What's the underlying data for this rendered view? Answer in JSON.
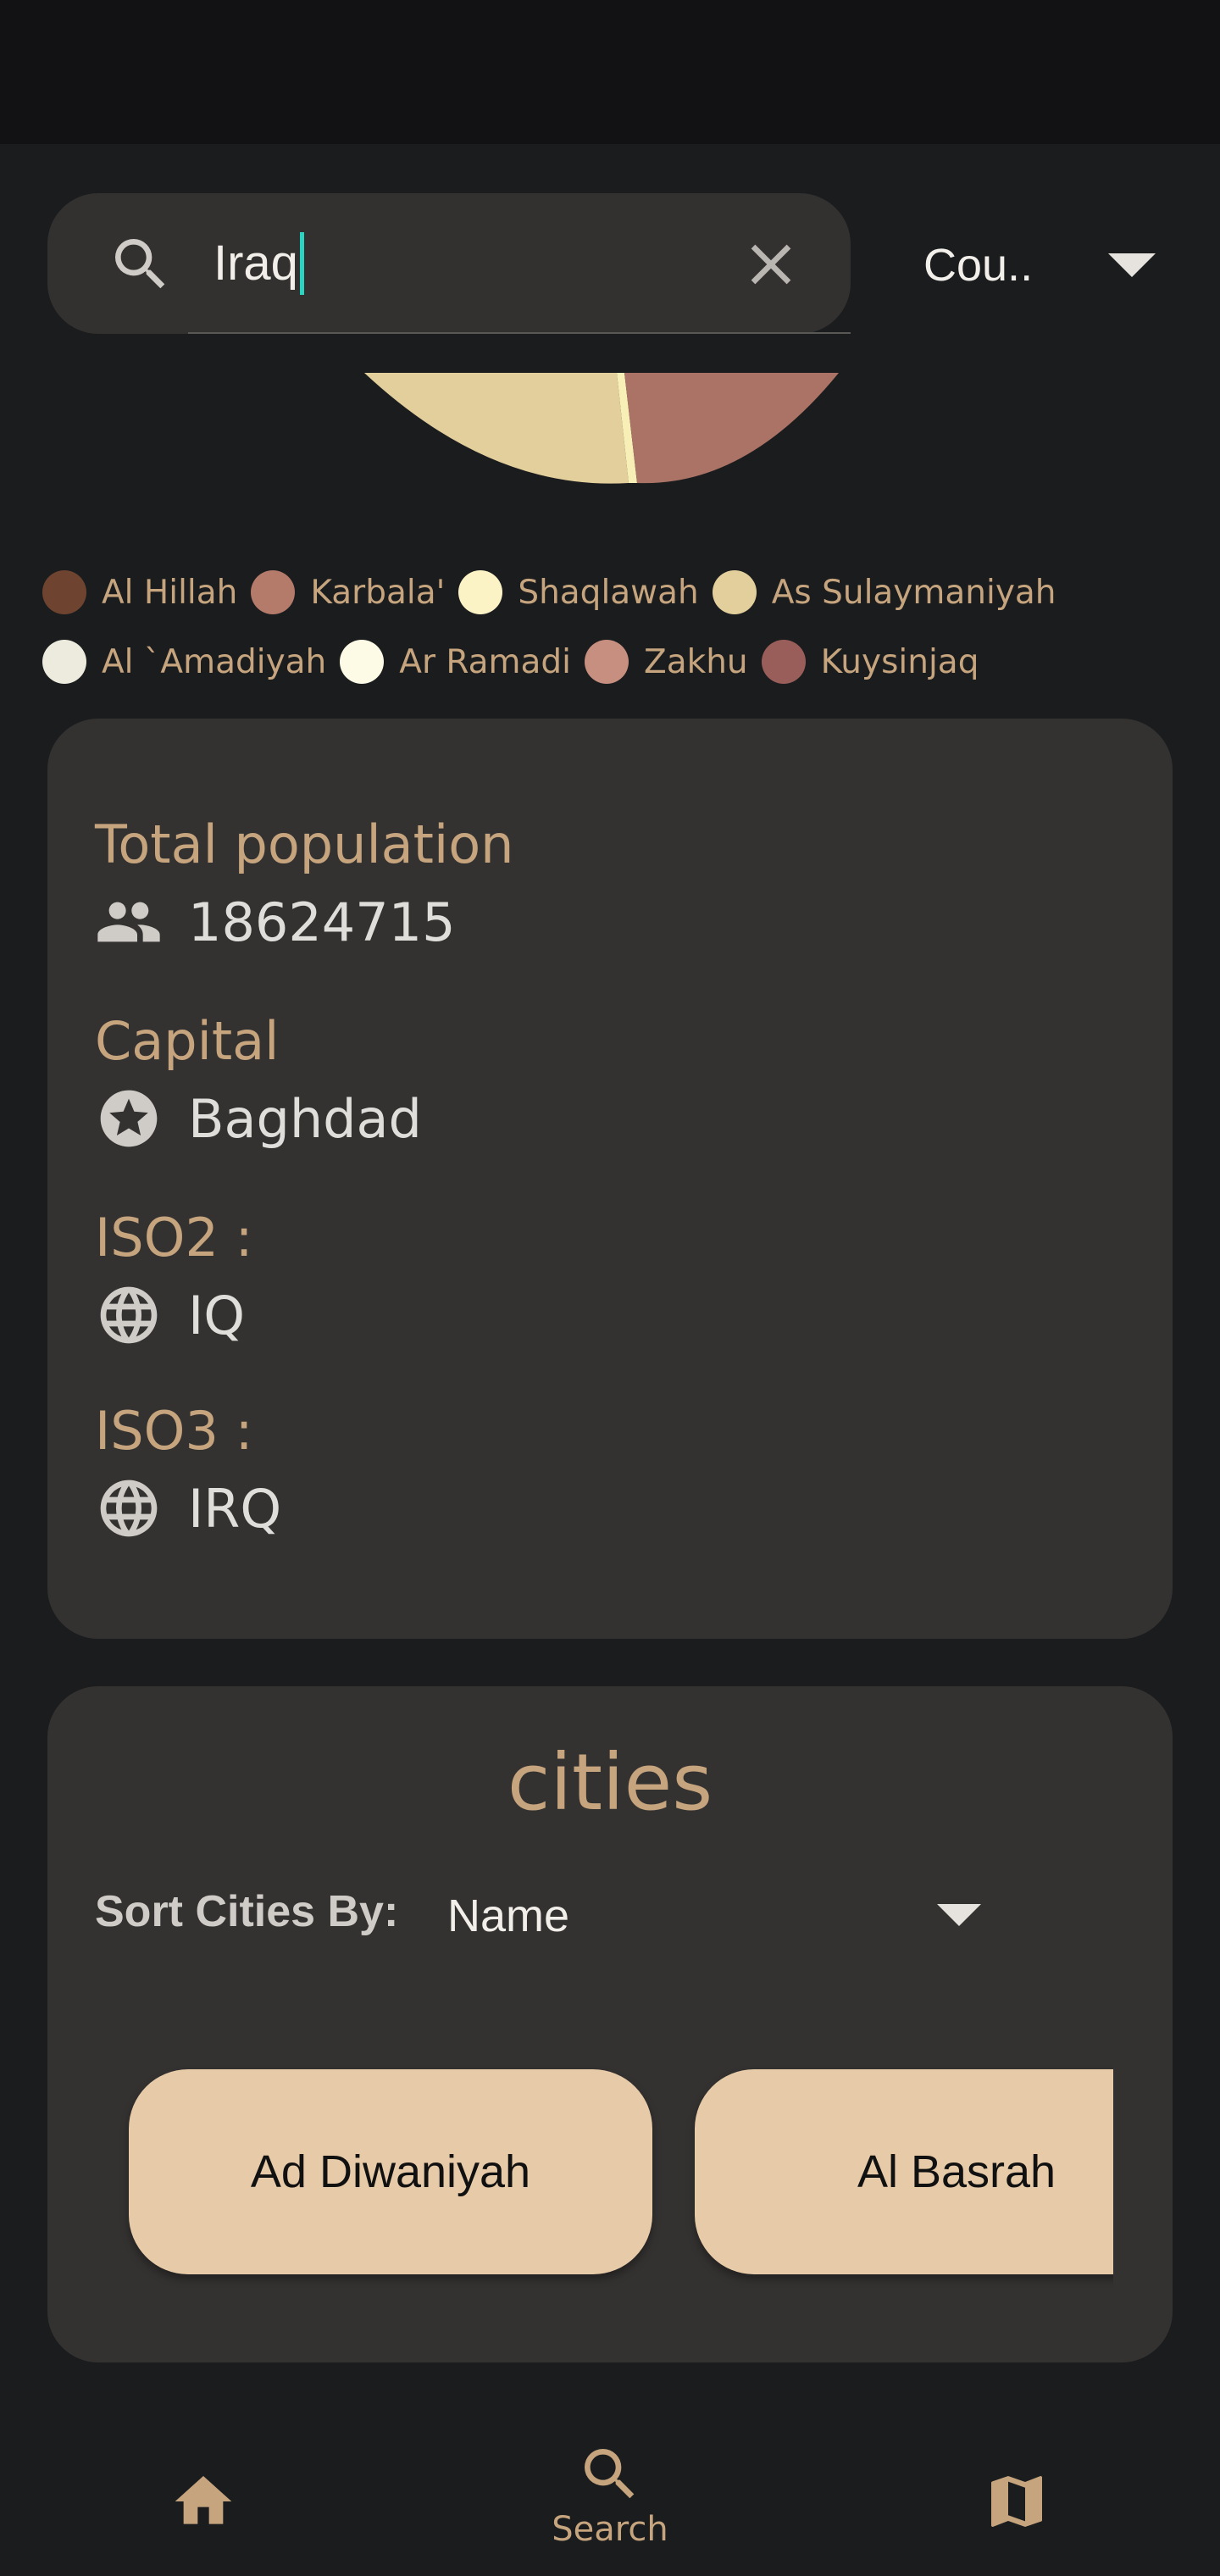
{
  "search": {
    "query": "Iraq",
    "filter_value": "Cou.."
  },
  "pie": {
    "slices": [
      {
        "color": "#e2cf9b"
      },
      {
        "color": "#f7efb6"
      },
      {
        "color": "#ab7365"
      }
    ]
  },
  "legend": {
    "rows": [
      [
        {
          "label": "Al Hillah",
          "color": "#6e4431"
        },
        {
          "label": "Karbala'",
          "color": "#b47a6a"
        },
        {
          "label": "Shaqlawah",
          "color": "#fbf2c6"
        },
        {
          "label": "As Sulaymaniyah",
          "color": "#e2cf9b"
        }
      ],
      [
        {
          "label": "Al `Amadiyah",
          "color": "#ecebde"
        },
        {
          "label": "Ar Ramadi",
          "color": "#fdfae6"
        },
        {
          "label": "Zakhu",
          "color": "#c68f80"
        },
        {
          "label": "Kuysinjaq",
          "color": "#9a5e5a"
        }
      ]
    ]
  },
  "info": {
    "population_label": "Total population",
    "population_value": "18624715",
    "capital_label": "Capital",
    "capital_value": "Baghdad",
    "iso2_label": "ISO2 :",
    "iso2_value": "IQ",
    "iso3_label": "ISO3 :",
    "iso3_value": "IRQ"
  },
  "cities": {
    "title": "cities",
    "sort_label": "Sort Cities By:",
    "sort_value": "Name",
    "items": [
      "Ad Diwaniyah",
      "Al Basrah"
    ]
  },
  "nav": {
    "search_label": "Search"
  },
  "colors": {
    "accent": "#c5a47e",
    "chip": "#e7cba9",
    "card": "#343231",
    "background": "#1b1c1e",
    "caret": "#2ad4c0"
  }
}
